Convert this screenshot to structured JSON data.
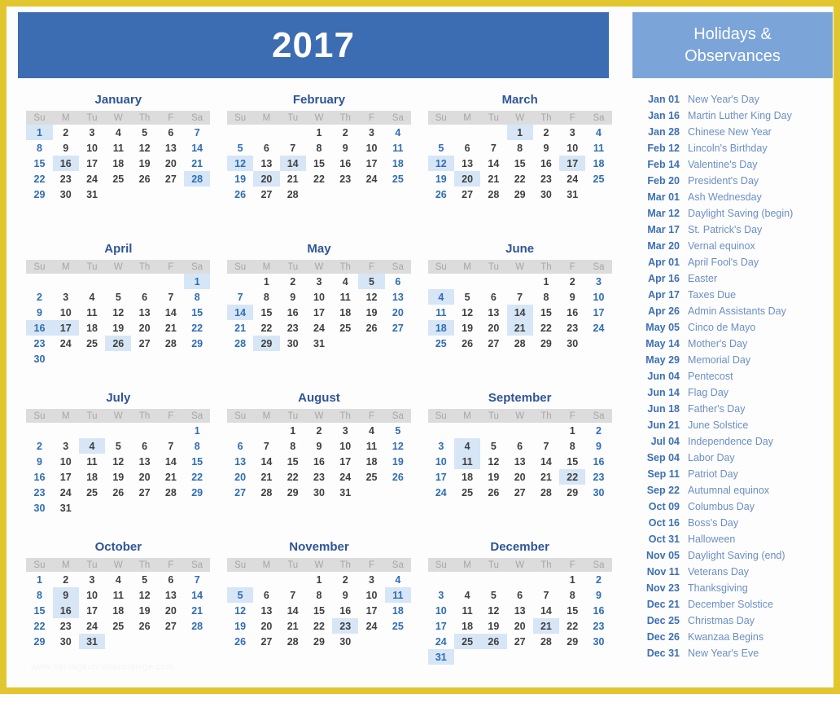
{
  "border_color": "#e2c62e",
  "header": {
    "year": "2017",
    "bg_color": "#3c6cb2"
  },
  "sidebar": {
    "title_line1": "Holidays &",
    "title_line2": "Observances",
    "bg_color": "#7ba4d8",
    "holidays": [
      {
        "date": "Jan 01",
        "name": "New Year's Day"
      },
      {
        "date": "Jan 16",
        "name": "Martin Luther King Day"
      },
      {
        "date": "Jan 28",
        "name": "Chinese New Year"
      },
      {
        "date": "Feb 12",
        "name": "Lincoln's Birthday"
      },
      {
        "date": "Feb 14",
        "name": "Valentine's Day"
      },
      {
        "date": "Feb 20",
        "name": "President's Day"
      },
      {
        "date": "Mar 01",
        "name": "Ash Wednesday"
      },
      {
        "date": "Mar 12",
        "name": "Daylight Saving (begin)"
      },
      {
        "date": "Mar 17",
        "name": "St. Patrick's Day"
      },
      {
        "date": "Mar 20",
        "name": "Vernal equinox"
      },
      {
        "date": "Apr 01",
        "name": "April Fool's Day"
      },
      {
        "date": "Apr 16",
        "name": "Easter"
      },
      {
        "date": "Apr 17",
        "name": "Taxes Due"
      },
      {
        "date": "Apr 26",
        "name": "Admin Assistants Day"
      },
      {
        "date": "May 05",
        "name": "Cinco de Mayo"
      },
      {
        "date": "May 14",
        "name": "Mother's Day"
      },
      {
        "date": "May 29",
        "name": "Memorial Day"
      },
      {
        "date": "Jun 04",
        "name": "Pentecost"
      },
      {
        "date": "Jun 14",
        "name": "Flag Day"
      },
      {
        "date": "Jun 18",
        "name": "Father's Day"
      },
      {
        "date": "Jun 21",
        "name": "June Solstice"
      },
      {
        "date": "Jul 04",
        "name": "Independence Day"
      },
      {
        "date": "Sep 04",
        "name": "Labor Day"
      },
      {
        "date": "Sep 11",
        "name": "Patriot Day"
      },
      {
        "date": "Sep 22",
        "name": "Autumnal equinox"
      },
      {
        "date": "Oct 09",
        "name": "Columbus Day"
      },
      {
        "date": "Oct 16",
        "name": "Boss's Day"
      },
      {
        "date": "Oct 31",
        "name": "Halloween"
      },
      {
        "date": "Nov 05",
        "name": "Daylight Saving (end)"
      },
      {
        "date": "Nov 11",
        "name": "Veterans Day"
      },
      {
        "date": "Nov 23",
        "name": "Thanksgiving"
      },
      {
        "date": "Dec 21",
        "name": "December Solstice"
      },
      {
        "date": "Dec 25",
        "name": "Christmas Day"
      },
      {
        "date": "Dec 26",
        "name": "Kwanzaa Begins"
      },
      {
        "date": "Dec 31",
        "name": "New Year's Eve"
      }
    ]
  },
  "calendar": {
    "weekday_headers": [
      "Su",
      "M",
      "Tu",
      "W",
      "Th",
      "F",
      "Sa"
    ],
    "highlight_color": "#d6e6f7",
    "weekend_color": "#2f6db5",
    "weekday_color": "#3f3f3f",
    "months": [
      {
        "name": "January",
        "days": 31,
        "start": 0,
        "highlights": [
          1,
          16,
          28
        ]
      },
      {
        "name": "February",
        "days": 28,
        "start": 3,
        "highlights": [
          12,
          14,
          20
        ]
      },
      {
        "name": "March",
        "days": 31,
        "start": 3,
        "highlights": [
          1,
          12,
          17,
          20
        ]
      },
      {
        "name": "April",
        "days": 30,
        "start": 6,
        "highlights": [
          1,
          16,
          17,
          26
        ]
      },
      {
        "name": "May",
        "days": 31,
        "start": 1,
        "highlights": [
          5,
          14,
          29
        ]
      },
      {
        "name": "June",
        "days": 30,
        "start": 4,
        "highlights": [
          4,
          14,
          18,
          21
        ]
      },
      {
        "name": "July",
        "days": 31,
        "start": 6,
        "highlights": [
          4
        ]
      },
      {
        "name": "August",
        "days": 31,
        "start": 2,
        "highlights": []
      },
      {
        "name": "September",
        "days": 30,
        "start": 5,
        "highlights": [
          4,
          11,
          22
        ]
      },
      {
        "name": "October",
        "days": 31,
        "start": 0,
        "highlights": [
          9,
          16,
          31
        ]
      },
      {
        "name": "November",
        "days": 30,
        "start": 3,
        "highlights": [
          5,
          11,
          23
        ]
      },
      {
        "name": "December",
        "days": 31,
        "start": 5,
        "highlights": [
          21,
          25,
          26,
          31
        ]
      }
    ]
  },
  "watermark": "www.heritagechristiancollege.com"
}
